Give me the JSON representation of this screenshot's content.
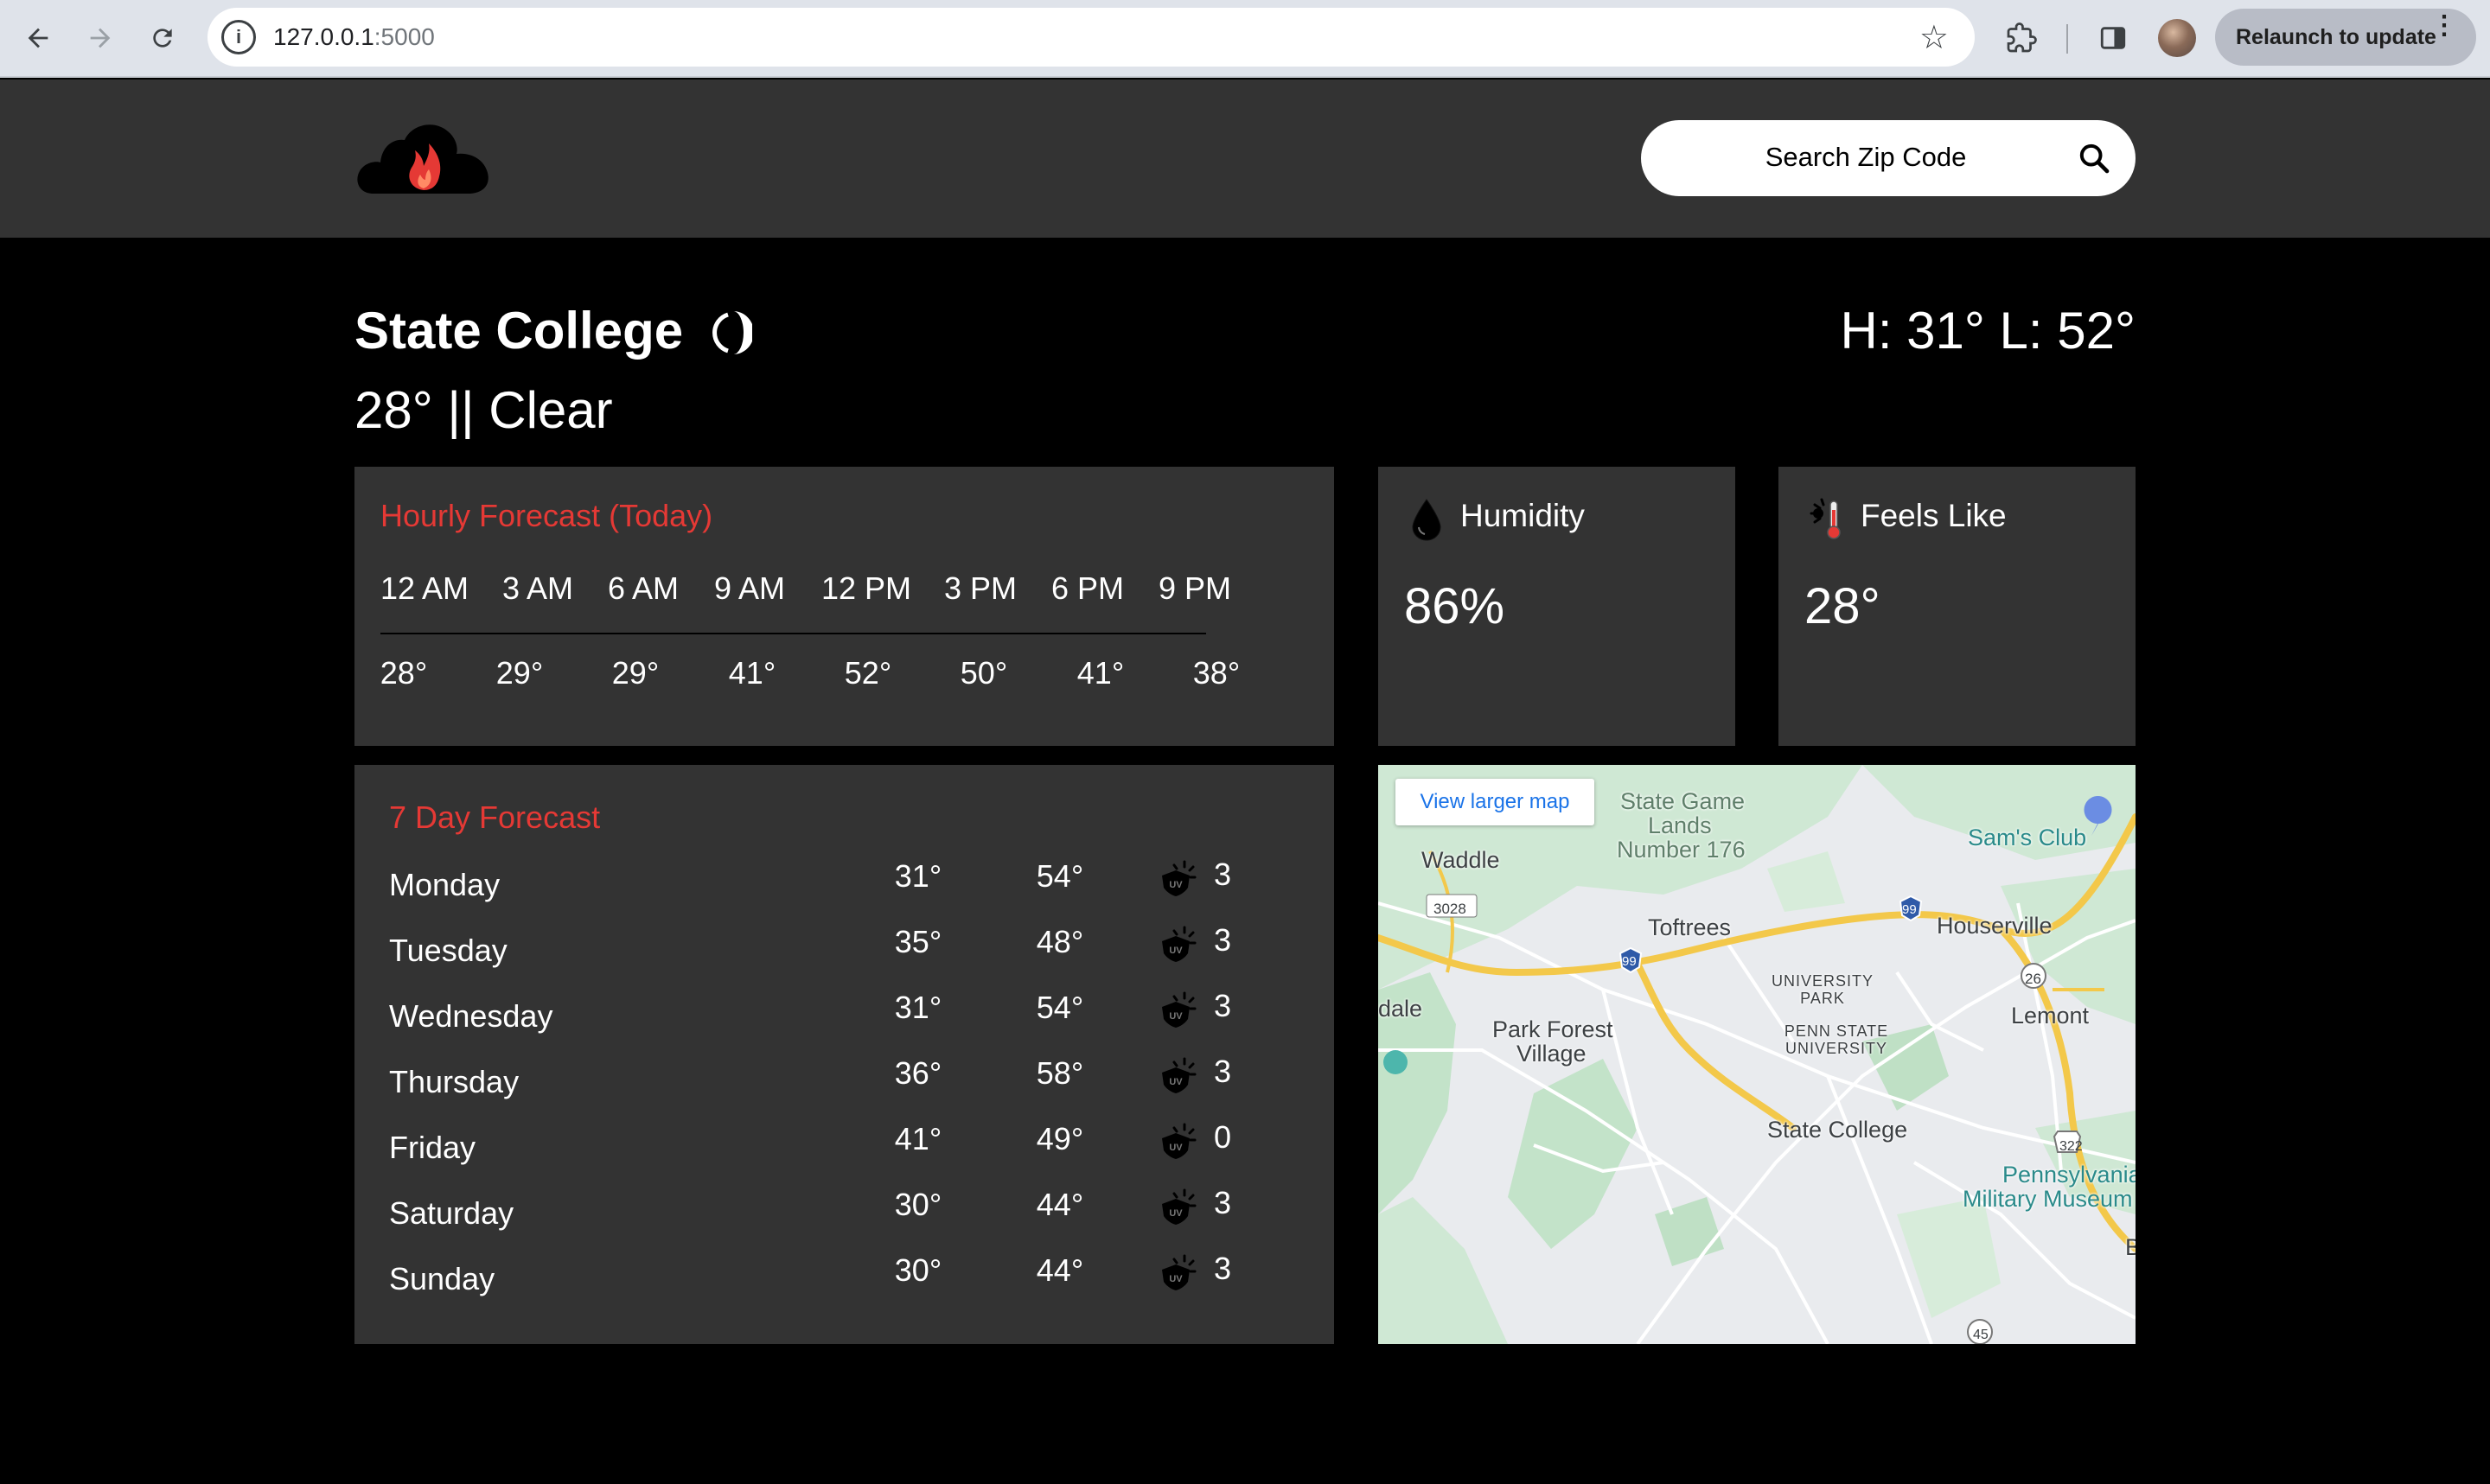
{
  "browser": {
    "url_host": "127.0.0.1",
    "url_port": ":5000",
    "relaunch_label": "Relaunch to update"
  },
  "header": {
    "search_placeholder": "Search Zip Code"
  },
  "current": {
    "city": "State College",
    "hi_lo": "H: 31° L: 52°",
    "condition_line": "28° || Clear"
  },
  "hourly": {
    "title": "Hourly Forecast (Today)",
    "times": [
      "12 AM",
      "3 AM",
      "6 AM",
      "9 AM",
      "12 PM",
      "3 PM",
      "6 PM",
      "9 PM"
    ],
    "temps": [
      "28°",
      "29°",
      "29°",
      "41°",
      "52°",
      "50°",
      "41°",
      "38°"
    ]
  },
  "humidity": {
    "title": "Humidity",
    "value": "86%"
  },
  "feels_like": {
    "title": "Feels Like",
    "value": "28°"
  },
  "weekly": {
    "title": "7 Day Forecast",
    "days": [
      {
        "day": "Monday",
        "hi": "31°",
        "lo": "54°",
        "uv": "3"
      },
      {
        "day": "Tuesday",
        "hi": "35°",
        "lo": "48°",
        "uv": "3"
      },
      {
        "day": "Wednesday",
        "hi": "31°",
        "lo": "54°",
        "uv": "3"
      },
      {
        "day": "Thursday",
        "hi": "36°",
        "lo": "58°",
        "uv": "3"
      },
      {
        "day": "Friday",
        "hi": "41°",
        "lo": "49°",
        "uv": "0"
      },
      {
        "day": "Saturday",
        "hi": "30°",
        "lo": "44°",
        "uv": "3"
      },
      {
        "day": "Sunday",
        "hi": "30°",
        "lo": "44°",
        "uv": "3"
      }
    ]
  },
  "map": {
    "view_larger": "View larger map",
    "labels": {
      "state_game_lands_1": "State Game",
      "state_game_lands_2": "Lands",
      "state_game_lands_3": "Number 176",
      "sams_club": "Sam's Club",
      "waddle": "Waddle",
      "route_3028": "3028",
      "toftrees": "Toftrees",
      "houserville": "Houserville",
      "route_99a": "99",
      "route_99b": "99",
      "route_26": "26",
      "university_park_1": "UNIVERSITY",
      "university_park_2": "PARK",
      "dale": "dale",
      "lemont": "Lemont",
      "park_forest_1": "Park Forest",
      "park_forest_2": "Village",
      "penn_state_1": "PENN STATE",
      "penn_state_2": "UNIVERSITY",
      "state_college": "State College",
      "route_322": "322",
      "pa_museum_1": "Pennsylvania",
      "pa_museum_2": "Military Museum",
      "edge_b": "B",
      "route_45": "45"
    }
  },
  "colors": {
    "accent_red": "#e53935",
    "panel_bg": "#333333",
    "page_bg": "#000000"
  },
  "icons": {
    "logo": "flame-cloud-icon",
    "search": "search-icon",
    "moon": "moon-phase-icon",
    "humidity": "droplet-icon",
    "feels_like": "thermometer-icon",
    "uv": "uv-sun-icon"
  }
}
